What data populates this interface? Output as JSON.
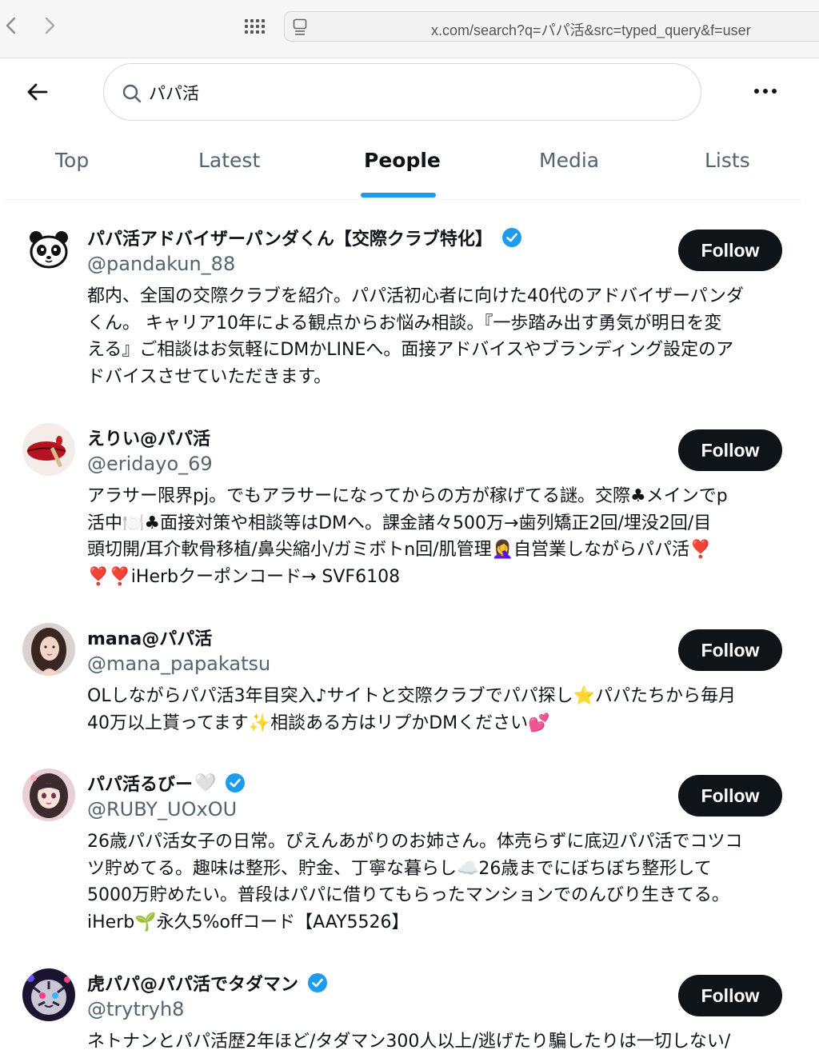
{
  "browser": {
    "url": "x.com/search?q=パパ活&src=typed_query&f=user"
  },
  "search": {
    "query": "パパ活"
  },
  "tabs": [
    {
      "label": "Top"
    },
    {
      "label": "Latest"
    },
    {
      "label": "People"
    },
    {
      "label": "Media"
    },
    {
      "label": "Lists"
    }
  ],
  "active_tab": "People",
  "follow_label": "Follow",
  "colors": {
    "accent": "#1d9bf0",
    "follow_button": "#0f1419",
    "secondary_text": "#536471"
  },
  "users": [
    {
      "name": "パパ活アドバイザーパンダくん【交際クラブ特化】",
      "verified": true,
      "handle": "@pandakun_88",
      "avatar": "panda-avatar",
      "bio_lines": [
        "都内、全国の交際クラブを紹介。パパ活初心者に向けた40代のアドバイザーパンダ",
        "くん。 キャリア10年による観点からお悩み相談。『一歩踏み出す勇気が明日を変",
        "える』ご相談はお気軽にDMかLINEへ。面接アドバイスやブランディング設定のア",
        "ドバイスさせていただきます。"
      ]
    },
    {
      "name": "えりい@パパ活",
      "verified": false,
      "handle": "@eridayo_69",
      "avatar": "lips-avatar",
      "bio_lines": [
        "アラサー限界pj。でもアラサーになってからの方が稼げてる謎。交際♣メインでp",
        "活中🍽️♣面接対策や相談等はDMへ。課金諸々500万→歯列矯正2回/埋没2回/目",
        "頭切開/耳介軟骨移植/鼻尖縮小/ガミボトn回/肌管理🤦‍♀️自営業しながらパパ活❣️",
        "❣️❣️iHerbクーポンコード→ SVF6108"
      ]
    },
    {
      "name": "mana@パパ活",
      "verified": false,
      "handle": "@mana_papakatsu",
      "avatar": "woman-avatar",
      "bio_lines": [
        "OLしながらパパ活3年目突入♪サイトと交際クラブでパパ探し⭐パパたちから毎月",
        "40万以上貰ってます✨相談ある方はリプかDMください💕"
      ]
    },
    {
      "name": "パパ活るびー",
      "name_emoji": "🤍",
      "verified": true,
      "handle": "@RUBY_UOxOU",
      "avatar": "anime-girl-avatar",
      "bio_lines": [
        "26歳パパ活女子の日常。ぴえんあがりのお姉さん。体売らずに底辺パパ活でコツコ",
        "ツ貯めてる。趣味は整形、貯金、丁寧な暮らし☁️26歳までにぼちぼち整形して",
        "5000万貯めたい。普段はパパに借りてもらったマンションでのんびり生きてる。",
        "iHerb🌱永久5%offコード【AAY5526】"
      ]
    },
    {
      "name": "虎パパ@パパ活でタダマン",
      "verified": true,
      "handle": "@trytryh8",
      "avatar": "tiger-avatar",
      "bio_lines": [
        "ネトナンとパパ活歴2年ほど/タダマン300人以上/逃げたり騙したりは一切しない/"
      ]
    }
  ]
}
